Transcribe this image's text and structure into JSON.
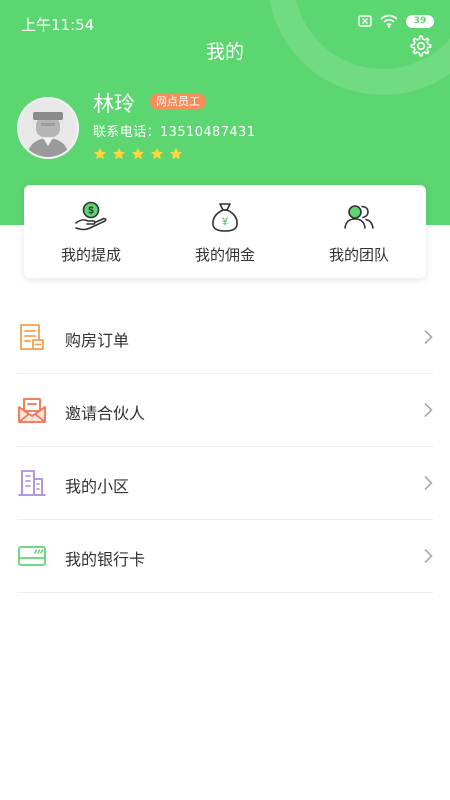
{
  "status_bar": {
    "time": "上午11:54",
    "battery": "39"
  },
  "header": {
    "title": "我的"
  },
  "profile": {
    "name": "林玲",
    "role_badge": "网点员工",
    "phone_label": "联系电话：",
    "phone": "13510487431",
    "rating": 5
  },
  "actions": [
    {
      "label": "我的提成",
      "icon": "money-hand-icon"
    },
    {
      "label": "我的佣金",
      "icon": "money-bag-icon"
    },
    {
      "label": "我的团队",
      "icon": "team-icon"
    }
  ],
  "menu": [
    {
      "label": "购房订单",
      "icon": "order-document-icon"
    },
    {
      "label": "邀请合伙人",
      "icon": "invite-envelope-icon"
    },
    {
      "label": "我的小区",
      "icon": "building-icon"
    },
    {
      "label": "我的银行卡",
      "icon": "bank-card-icon"
    }
  ],
  "colors": {
    "primary": "#5cd670",
    "badge": "#f68d5a",
    "star": "#ffd53e",
    "order_icon": "#f5a04a",
    "invite_icon": "#f0714e",
    "building_icon": "#a98be0",
    "card_icon": "#5cd670"
  }
}
